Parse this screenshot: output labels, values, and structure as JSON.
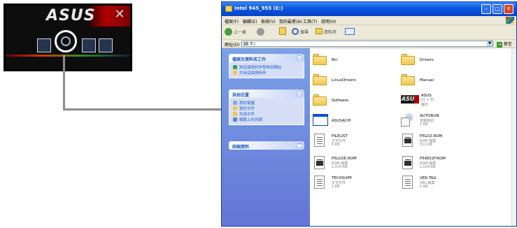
{
  "cd_menu": {
    "logo": "ASUS"
  },
  "window": {
    "title": "Intel 945_955 (E:)",
    "menu": [
      "檔案(F)",
      "編輯(E)",
      "檢視(V)",
      "我的最愛(A)",
      "工具(T)",
      "說明(H)"
    ],
    "toolbar": {
      "back": "上一頁",
      "search": "搜尋",
      "folders": "資料夾"
    },
    "address": {
      "label": "網址(D)",
      "value": "E:\\",
      "go": "移至"
    },
    "tasks": [
      {
        "header": "檔案及資料夾工作",
        "links": [
          "將這個資料夾發佈到網站",
          "共用這個資料夾"
        ]
      },
      {
        "header": "其他位置",
        "links": [
          "我的電腦",
          "我的文件",
          "共用文件",
          "網路上的芳鄰"
        ]
      },
      {
        "header": "詳細資料",
        "links": []
      }
    ],
    "items": [
      {
        "name": "Bin",
        "type": "folder"
      },
      {
        "name": "Drivers",
        "type": "folder"
      },
      {
        "name": "LinuxDrivers",
        "type": "folder"
      },
      {
        "name": "Manual",
        "type": "folder"
      },
      {
        "name": "Software",
        "type": "folder"
      },
      {
        "name": "ASUS",
        "type": "icon",
        "l1": "32 x 32",
        "l2": "圖示"
      },
      {
        "name": "ASUSACPI",
        "type": "app"
      },
      {
        "name": "AUTORUN",
        "type": "autorun",
        "l1": "安裝資訊",
        "l2": "1 KB"
      },
      {
        "name": "FILELIST",
        "type": "text",
        "l1": "文字文件",
        "l2": "6 KB"
      },
      {
        "name": "P5LD2.ROM",
        "type": "rom",
        "l1": "ROM 檔案",
        "l2": "512 KB"
      },
      {
        "name": "P5LD2E.ROM",
        "type": "rom",
        "l1": "ROM 檔案",
        "l2": "1,024 KB"
      },
      {
        "name": "P5WD2F.ROM",
        "type": "rom",
        "l1": "ROM 檔案",
        "l2": "1,024 KB"
      },
      {
        "name": "TECHSUPP",
        "type": "text",
        "l1": "文字文件",
        "l2": "2 KB"
      },
      {
        "name": "VER.TAG",
        "type": "text",
        "l1": "TAG 檔案",
        "l2": "1 KB"
      }
    ]
  }
}
